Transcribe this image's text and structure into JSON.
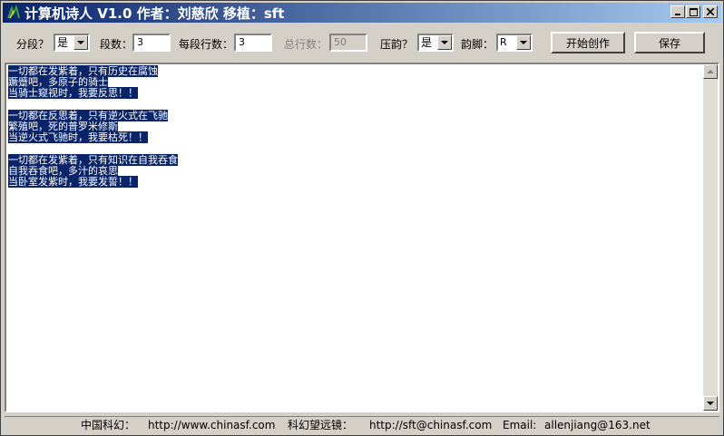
{
  "window": {
    "title": "计算机诗人 V1.0 作者：刘慈欣 移植：sft",
    "minimize": "_",
    "maximize": "□",
    "close": "×"
  },
  "toolbar": {
    "split_label": "分段？",
    "split_value": "是",
    "stanzas_label": "段数：",
    "stanzas_value": "3",
    "lines_label": "每段行数：",
    "lines_value": "3",
    "total_label": "总行数：",
    "total_value": "50",
    "rhyme_label": "压韵？",
    "rhyme_value": "是",
    "rhyme_foot_label": "韵脚：",
    "rhyme_foot_value": "R",
    "start_button": "开始创作",
    "save_button": "保存"
  },
  "poem": {
    "stanzas": [
      [
        "一切都在发紫着，只有历史在腐蚀",
        "蹶蹙吧，多原子的骑士",
        "当骑士窥视时，我要反思！！"
      ],
      [
        "一切都在反思着，只有逆火式在飞驰",
        "繁殖吧，死的普罗米修斯",
        "当逆火式飞驰时，我要枯死！！"
      ],
      [
        "一切都在发紫着，只有知识在自我吞食",
        "自我吞食吧，多汁的哀思",
        "当卧室发紫时，我要发誓！！"
      ]
    ]
  },
  "status": {
    "site1_label": "中国科幻：",
    "site1_url": "http://www.chinasf.com",
    "site2_label": "科幻望远镜：",
    "site2_url": "http://sft@chinasf.com",
    "email_label": "Email:",
    "email_value": "allenjiang@163.net"
  },
  "colors": {
    "title_start": "#0a246a",
    "title_end": "#a6caf0",
    "selection": "#0a246a",
    "face": "#d4d0c8"
  }
}
